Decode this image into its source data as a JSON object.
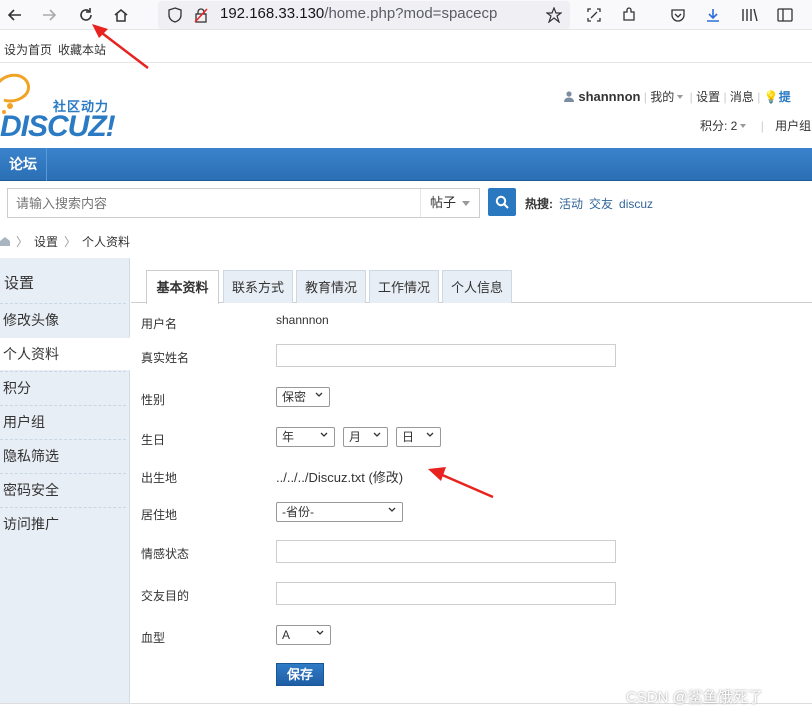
{
  "browser": {
    "url_host": "192.168.33.130",
    "url_path": "/home.php?mod=spacecp"
  },
  "topnav": {
    "set_home": "设为首页",
    "bookmark": "收藏本站"
  },
  "header": {
    "logo_text": "社区动力",
    "logo_brand": "DISCUZ!",
    "username": "shannnon",
    "my": "我的",
    "settings": "设置",
    "messages": "消息",
    "remind": "提",
    "points": "积分: 2",
    "usergroup": "用户组"
  },
  "nav": {
    "forum": "论坛"
  },
  "search": {
    "placeholder": "请输入搜索内容",
    "type": "帖子",
    "hot_label": "热搜:",
    "hot_links": [
      "活动",
      "交友",
      "discuz"
    ]
  },
  "breadcrumb": {
    "settings": "设置",
    "profile": "个人资料"
  },
  "sidebar": {
    "title": "设置",
    "items": [
      "修改头像",
      "个人资料",
      "积分",
      "用户组",
      "隐私筛选",
      "密码安全",
      "访问推广"
    ],
    "active_index": 1
  },
  "tabs": [
    "基本资料",
    "联系方式",
    "教育情况",
    "工作情况",
    "个人信息"
  ],
  "form": {
    "username_label": "用户名",
    "username_value": "shannnon",
    "realname_label": "真实姓名",
    "gender_label": "性别",
    "gender_value": "保密",
    "birthday_label": "生日",
    "year": "年",
    "month": "月",
    "day": "日",
    "birthplace_label": "出生地",
    "birthplace_value": "../../../Discuz.txt (修改)",
    "residence_label": "居住地",
    "province": "-省份-",
    "affective_label": "情感状态",
    "lookingfor_label": "交友目的",
    "bloodtype_label": "血型",
    "bloodtype_value": "A",
    "save": "保存"
  },
  "watermark": "CSDN @鲨鱼饿死了"
}
